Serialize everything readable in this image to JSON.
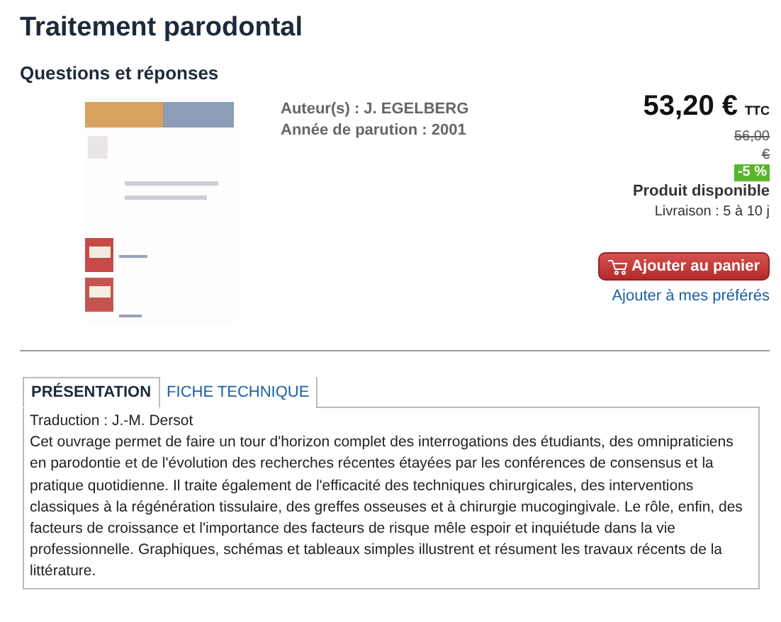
{
  "title": "Traitement parodontal",
  "subtitle": "Questions et réponses",
  "details": [
    {
      "label": "Auteur(s) :",
      "value": "J. EGELBERG"
    },
    {
      "label": "Année de parution :",
      "value": "2001"
    }
  ],
  "price": {
    "amount": "53,20 €",
    "tax": "TTC",
    "old": "56,00 €",
    "discount": "-5 %",
    "availability": "Produit disponible",
    "delivery": "Livraison : 5 à 10 j"
  },
  "cart_button": "Ajouter au panier",
  "favorites_link": "Ajouter à mes préférés",
  "tabs": [
    {
      "label": "PRÉSENTATION",
      "selected": true
    },
    {
      "label": "FICHE TECHNIQUE",
      "selected": false
    }
  ],
  "panel": {
    "lines": [
      "Traduction : J.-M. Dersot",
      "Cet ouvrage permet de faire un tour d'horizon complet des interrogations des étudiants, des omnipraticiens en parodontie et de l'évolution des recherches récentes étayées par les conférences de consensus et la pratique quotidienne. Il traite également de l'efficacité des techniques chirurgicales, des interventions classiques à la régénération tissulaire, des greffes osseuses et à chirurgie mucogingivale. Le rôle, enfin, des facteurs de croissance et l'importance des facteurs de risque mêle espoir et inquiétude dans la vie professionnelle. Graphiques, schémas et tableaux simples illustrent et résument les travaux récents de la littérature."
    ]
  }
}
